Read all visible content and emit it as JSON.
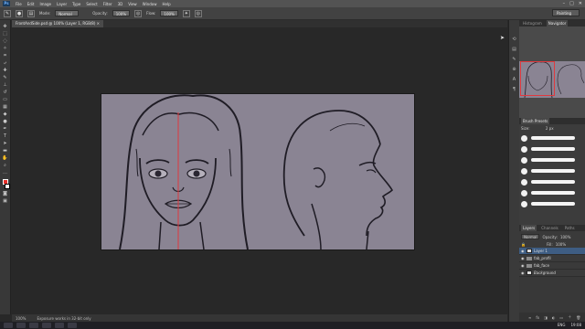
{
  "app": {
    "logo": "Ps"
  },
  "menu": [
    "File",
    "Edit",
    "Image",
    "Layer",
    "Type",
    "Select",
    "Filter",
    "3D",
    "View",
    "Window",
    "Help"
  ],
  "window_controls": {
    "minimize": "–",
    "maximize": "□",
    "close": "✕"
  },
  "options_bar": {
    "mode_label": "Mode:",
    "mode_value": "Normal",
    "opacity_label": "Opacity:",
    "opacity_value": "100%",
    "flow_label": "Flow:",
    "flow_value": "100%",
    "workspace": "Painting"
  },
  "document": {
    "tab_title": "FrontAndSide.psd @ 100% (Layer 1, RGB/8)  ×",
    "guide_color": "#e0393e"
  },
  "status_bar": {
    "zoom": "100%",
    "info": "Exposure works in 32-bit only"
  },
  "taskbar": {
    "lang": "ENG",
    "time": "19:08"
  },
  "panels": {
    "top_tabs": [
      "Histogram",
      "Navigator"
    ],
    "brush_tab": "Brush Presets",
    "size_label": "Size:",
    "size_value": "2 px",
    "layers_tabs": [
      "Layers",
      "Channels",
      "Paths"
    ],
    "blend_mode": "Normal",
    "opacity_label": "Opacity:",
    "opacity_value": "100%",
    "fill_label": "Fill:",
    "fill_value": "100%",
    "layers": [
      {
        "name": "Layer 1",
        "selected": true,
        "type": "layer"
      },
      {
        "name": "fab_profil",
        "selected": false,
        "type": "folder"
      },
      {
        "name": "fab_face",
        "selected": false,
        "type": "folder"
      },
      {
        "name": "Background",
        "selected": false,
        "type": "layer"
      }
    ]
  },
  "colors": {
    "foreground": "#e8302a",
    "background": "#ffffff",
    "canvas": "#8a8493",
    "selected_layer": "#3e5d83"
  }
}
